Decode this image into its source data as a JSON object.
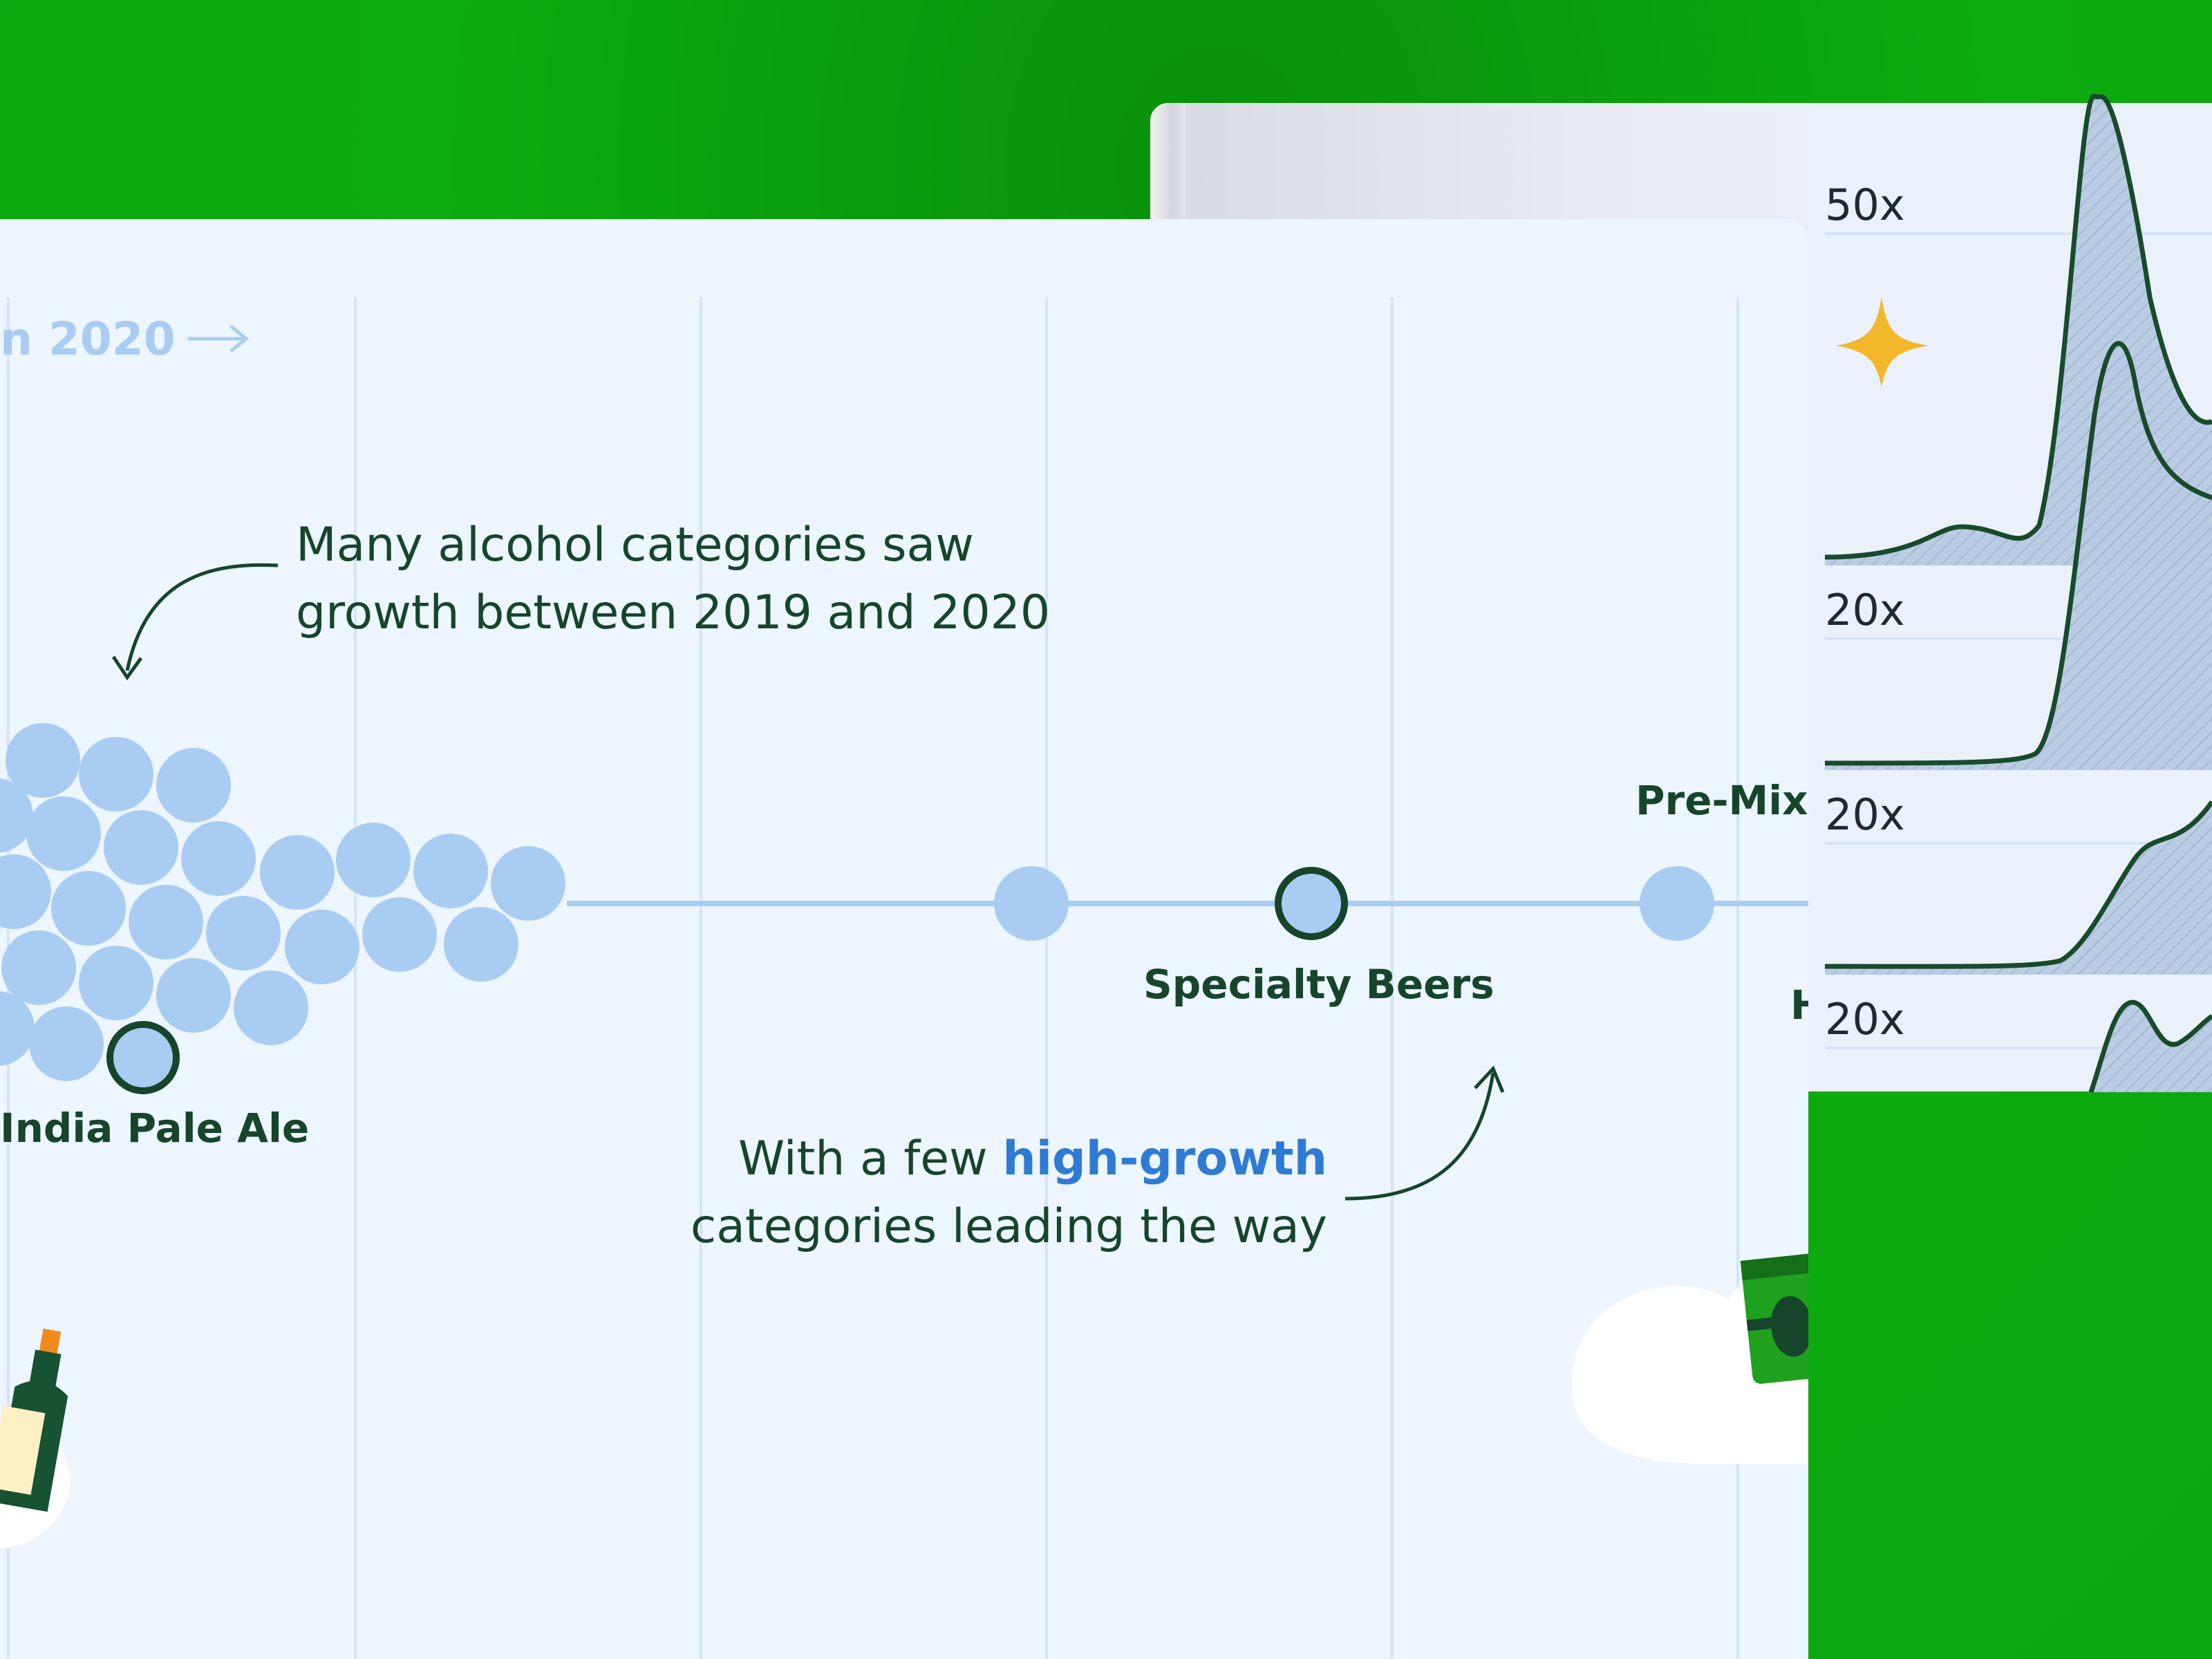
{
  "chart_data": {
    "type": "scatter",
    "title": "",
    "xlabel": "n 2020",
    "series": [
      {
        "points": [
          {
            "label": "India Pale Ale",
            "highlighted": true
          },
          {
            "label": "Specialty Beers",
            "highlighted": true
          },
          {
            "label": "Pre-Mixe",
            "highlighted": false
          },
          {
            "label": "H",
            "highlighted": false
          }
        ]
      }
    ],
    "annotations": [
      {
        "line1": "Many alcohol categories saw",
        "line2": "growth between 2019 and 2020"
      },
      {
        "line1_prefix": "With a few ",
        "line1_highlight": "high-growth",
        "line2": "categories leading the way"
      }
    ],
    "ridgeline": {
      "type": "area",
      "scale_labels": [
        "50x",
        "20x",
        "20x",
        "20x"
      ]
    },
    "colors": {
      "background_green": "#0bab0e",
      "card": "#edf5fe",
      "dot": "#a9ccf3",
      "dark_green": "#16452b",
      "highlight_blue": "#2f7bd3",
      "star": "#f2b72b"
    },
    "icons": [
      "arrow-right-icon",
      "wine-bottle-icon",
      "beer-can-icon",
      "star-icon",
      "cloud-icon"
    ]
  }
}
